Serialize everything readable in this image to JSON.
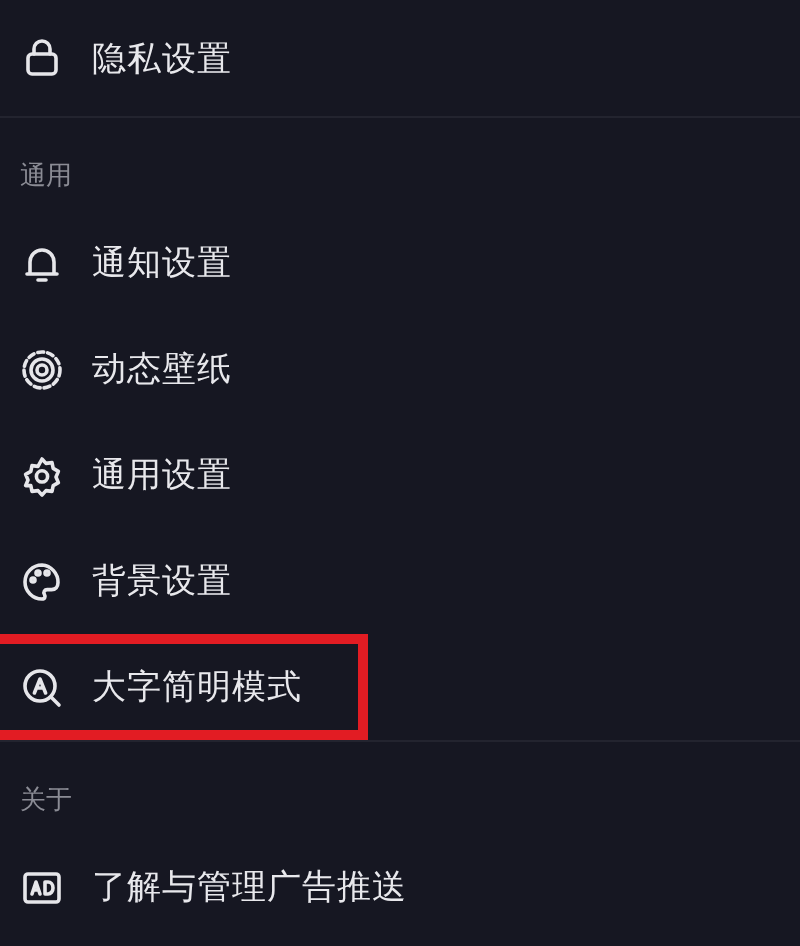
{
  "sections": [
    {
      "items": [
        {
          "label": "隐私设置",
          "highlighted": false
        }
      ]
    },
    {
      "header": "通用",
      "items": [
        {
          "label": "通知设置",
          "highlighted": false
        },
        {
          "label": "动态壁纸",
          "highlighted": false
        },
        {
          "label": "通用设置",
          "highlighted": false
        },
        {
          "label": "背景设置",
          "highlighted": false
        },
        {
          "label": "大字简明模式",
          "highlighted": true
        }
      ]
    },
    {
      "header": "关于",
      "items": [
        {
          "label": "了解与管理广告推送",
          "highlighted": false
        }
      ]
    }
  ]
}
